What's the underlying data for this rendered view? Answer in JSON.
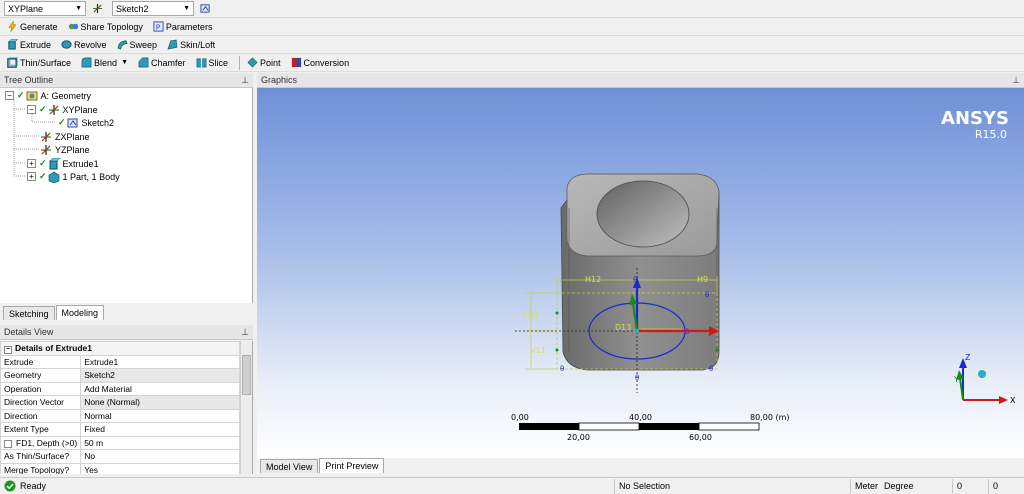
{
  "toolbar1": {
    "plane_select": "XYPlane",
    "sketch_select": "Sketch2"
  },
  "toolbar2": {
    "generate": "Generate",
    "share_topology": "Share Topology",
    "parameters": "Parameters"
  },
  "toolbar3": {
    "extrude": "Extrude",
    "revolve": "Revolve",
    "sweep": "Sweep",
    "skin_loft": "Skin/Loft"
  },
  "toolbar4": {
    "thin_surface": "Thin/Surface",
    "blend": "Blend",
    "chamfer": "Chamfer",
    "slice": "Slice",
    "point": "Point",
    "conversion": "Conversion"
  },
  "tree_outline": {
    "title": "Tree Outline",
    "items": [
      {
        "label": "A: Geometry"
      },
      {
        "label": "XYPlane"
      },
      {
        "label": "Sketch2"
      },
      {
        "label": "ZXPlane"
      },
      {
        "label": "YZPlane"
      },
      {
        "label": "Extrude1"
      },
      {
        "label": "1 Part, 1 Body"
      }
    ],
    "tabs": [
      "Sketching",
      "Modeling"
    ]
  },
  "details": {
    "title": "Details View",
    "header": "Details of Extrude1",
    "rows": [
      {
        "key": "Extrude",
        "value": "Extrude1"
      },
      {
        "key": "Geometry",
        "value": "Sketch2"
      },
      {
        "key": "Operation",
        "value": "Add Material"
      },
      {
        "key": "Direction Vector",
        "value": "None (Normal)"
      },
      {
        "key": "Direction",
        "value": "Normal"
      },
      {
        "key": "Extent Type",
        "value": "Fixed"
      },
      {
        "key": "FD1, Depth (>0)",
        "value": "50 m"
      },
      {
        "key": "As Thin/Surface?",
        "value": "No"
      },
      {
        "key": "Merge Topology?",
        "value": "Yes"
      }
    ]
  },
  "graphics": {
    "title": "Graphics",
    "brand": "ANSYS",
    "version": "R15.0",
    "dim_labels": [
      "H12",
      "H9",
      "V10",
      "V11",
      "D13"
    ],
    "scale_top": [
      "0,00",
      "40,00",
      "80,00 (m)"
    ],
    "scale_bottom": [
      "20,00",
      "60,00"
    ],
    "axes": {
      "z": "Z",
      "y": "Y",
      "x": "X"
    },
    "tabs": [
      "Model View",
      "Print Preview"
    ]
  },
  "status": {
    "ready": "Ready",
    "selection": "No Selection",
    "unit_length": "Meter",
    "unit_angle": "Degree",
    "val1": "0",
    "val2": "0"
  }
}
